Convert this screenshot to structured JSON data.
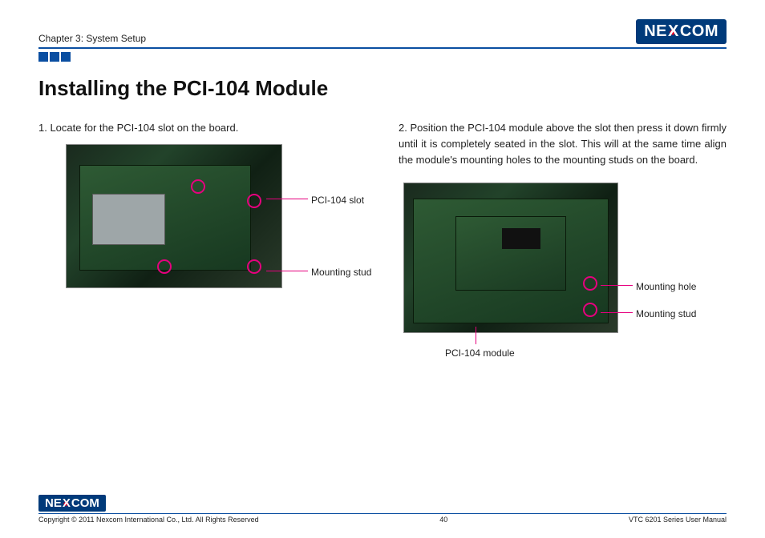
{
  "header": {
    "chapter": "Chapter 3: System Setup",
    "logo_text_pre": "n",
    "logo_text_e": "E",
    "logo_text_x": "X",
    "logo_text_post": "COM"
  },
  "title": "Installing the PCI-104 Module",
  "left": {
    "step1": "1. Locate for the PCI-104 slot on the board.",
    "ann_slot": "PCI-104 slot",
    "ann_stud": "Mounting stud"
  },
  "right": {
    "step2": "2. Position the PCI-104 module above the slot then press it down firmly until it is completely seated in the slot. This will at the same time align the module's mounting holes to the mounting studs on the board.",
    "ann_hole": "Mounting hole",
    "ann_stud": "Mounting stud",
    "ann_module": "PCI-104 module"
  },
  "footer": {
    "copyright": "Copyright © 2011 Nexcom International Co., Ltd. All Rights Reserved",
    "page": "40",
    "doc": "VTC 6201 Series User Manual"
  }
}
